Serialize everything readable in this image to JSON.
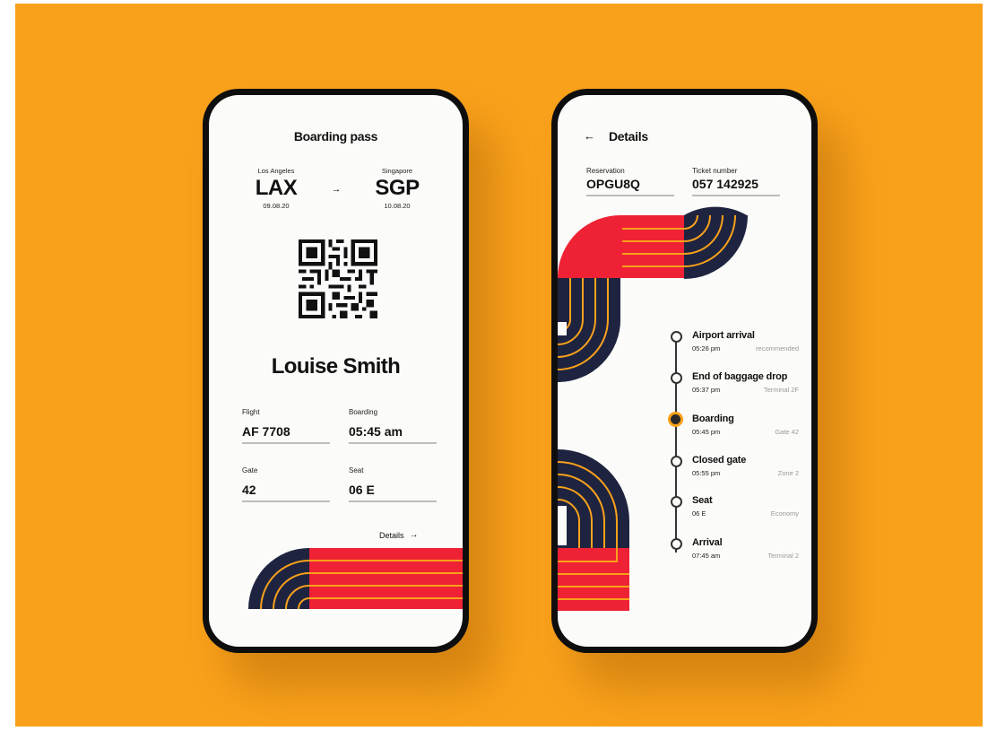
{
  "colors": {
    "background": "#F9A11B",
    "navy": "#1E2440",
    "red": "#EE2234",
    "line": "#F9A11B"
  },
  "boarding": {
    "title": "Boarding pass",
    "from": {
      "city": "Los Angeles",
      "code": "LAX",
      "date": "09.08.20"
    },
    "to": {
      "city": "Singapore",
      "code": "SGP",
      "date": "10.08.20"
    },
    "arrow": "→",
    "passenger": "Louise Smith",
    "fields": [
      {
        "label": "Flight",
        "value": "AF 7708"
      },
      {
        "label": "Boarding",
        "value": "05:45 am"
      },
      {
        "label": "Gate",
        "value": "42"
      },
      {
        "label": "Seat",
        "value": "06 E"
      }
    ],
    "details_link": "Details",
    "details_arrow": "→"
  },
  "details": {
    "back_icon": "←",
    "title": "Details",
    "reservation_label": "Reservation",
    "reservation": "OPGU8Q",
    "ticket_label": "Ticket number",
    "ticket": "057 142925",
    "timeline": [
      {
        "title": "Airport arrival",
        "time": "05:26 pm",
        "note": "recommended",
        "active": false
      },
      {
        "title": "End of baggage drop",
        "time": "05:37 pm",
        "note": "Terminal 2F",
        "active": false
      },
      {
        "title": "Boarding",
        "time": "05:45 pm",
        "note": "Gate 42",
        "active": true
      },
      {
        "title": "Closed gate",
        "time": "05:55 pm",
        "note": "Zone 2",
        "active": false
      },
      {
        "title": "Seat",
        "time": "06 E",
        "note": "Economy",
        "active": false
      },
      {
        "title": "Arrival",
        "time": "07:45 am",
        "note": "Terminal 2",
        "active": false
      }
    ]
  }
}
